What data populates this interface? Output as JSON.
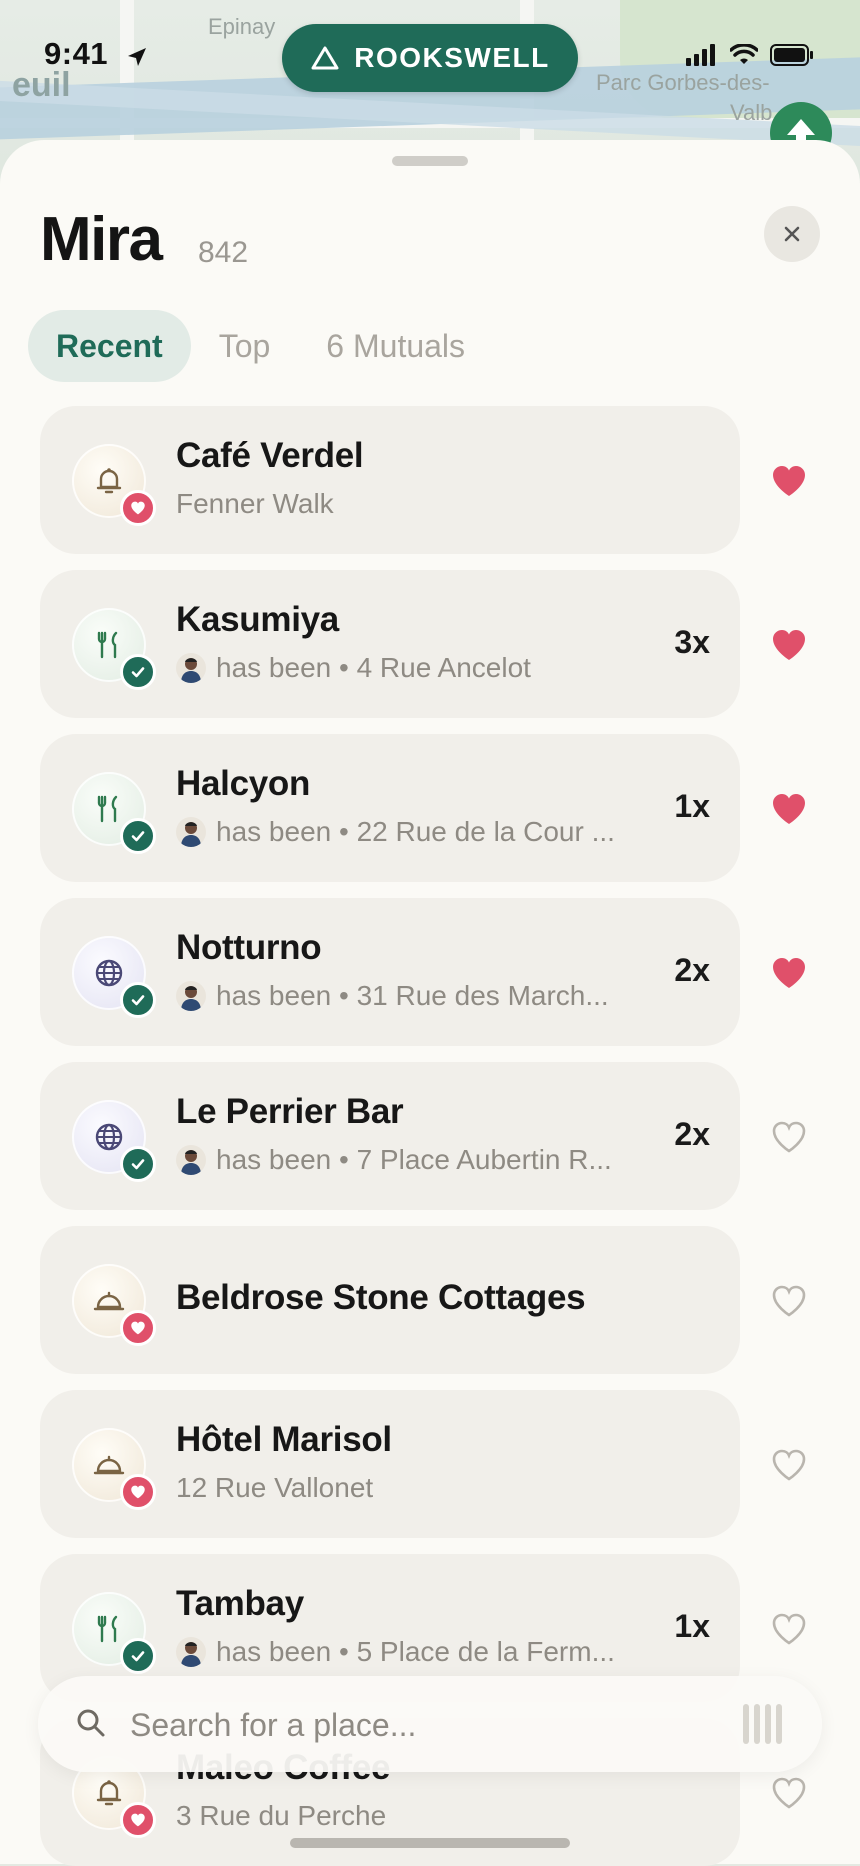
{
  "status": {
    "time": "9:41"
  },
  "map": {
    "label_left": "euil",
    "label_top": "Epinay",
    "label_park": "Parc Gorbes-des-",
    "label_park2": "Valb"
  },
  "brand": {
    "name": "ROOKSWELL"
  },
  "profile": {
    "name": "Mira",
    "count": "842"
  },
  "tabs": [
    {
      "label": "Recent",
      "active": true
    },
    {
      "label": "Top",
      "active": false
    },
    {
      "label": "6 Mutuals",
      "active": false
    }
  ],
  "places": [
    {
      "name": "Café Verdel",
      "subtitle": "Fenner Walk",
      "icon": "bell-icon",
      "badge": "heart",
      "has_been": false,
      "multiplier": "",
      "liked": true
    },
    {
      "name": "Kasumiya",
      "subtitle": "has been • 4 Rue Ancelot",
      "icon": "fork-knife-icon",
      "badge": "check",
      "has_been": true,
      "multiplier": "3x",
      "liked": true
    },
    {
      "name": "Halcyon",
      "subtitle": "has been • 22 Rue de la Cour ...",
      "icon": "fork-knife-icon",
      "badge": "check",
      "has_been": true,
      "multiplier": "1x",
      "liked": true
    },
    {
      "name": "Notturno",
      "subtitle": "has been • 31 Rue des March...",
      "icon": "globe-icon",
      "badge": "check",
      "has_been": true,
      "multiplier": "2x",
      "liked": true
    },
    {
      "name": "Le Perrier Bar",
      "subtitle": "has been • 7 Place Aubertin R...",
      "icon": "globe-icon",
      "badge": "check",
      "has_been": true,
      "multiplier": "2x",
      "liked": false
    },
    {
      "name": "Beldrose Stone Cottages",
      "subtitle": "",
      "icon": "hotel-bell-icon",
      "badge": "heart",
      "has_been": false,
      "multiplier": "",
      "liked": false
    },
    {
      "name": "Hôtel Marisol",
      "subtitle": "12 Rue Vallonet",
      "icon": "hotel-bell-icon",
      "badge": "heart",
      "has_been": false,
      "multiplier": "",
      "liked": false
    },
    {
      "name": "Tambay",
      "subtitle": "has been • 5 Place de la Ferm...",
      "icon": "fork-knife-icon",
      "badge": "check",
      "has_been": true,
      "multiplier": "1x",
      "liked": false
    },
    {
      "name": "Maleo Coffee",
      "subtitle": "3 Rue du Perche",
      "icon": "bell-icon",
      "badge": "heart",
      "has_been": false,
      "multiplier": "",
      "liked": false
    }
  ],
  "search": {
    "placeholder": "Search for a place..."
  },
  "colors": {
    "accent": "#1f6b58",
    "heart": "#e0506a",
    "sheet": "#fbfaf6",
    "row": "#f1efea"
  }
}
